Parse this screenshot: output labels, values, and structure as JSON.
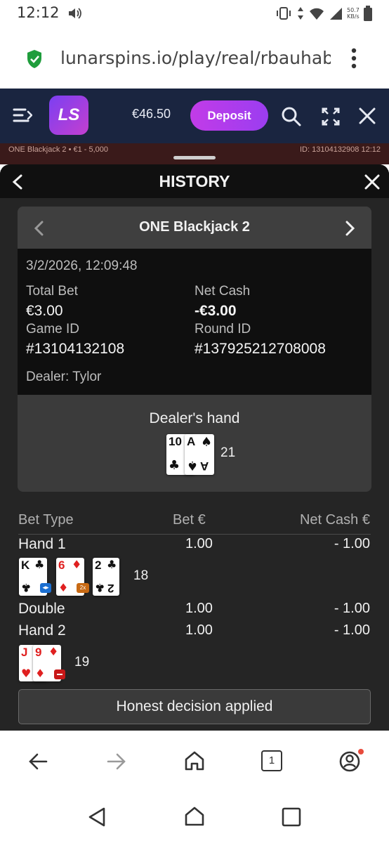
{
  "status_bar": {
    "time": "12:12",
    "net_speed": "50.7",
    "net_unit": "KB/s"
  },
  "browser": {
    "url": "lunarspins.io/play/real/rbauhaba"
  },
  "casino": {
    "balance": "€46.50",
    "deposit_label": "Deposit",
    "logo_text": "LS"
  },
  "game_strip": {
    "left": "ONE Blackjack 2 • €1 - 5,000",
    "right": "ID: 13104132908 12:12"
  },
  "history": {
    "title": "HISTORY",
    "game_name": "ONE Blackjack 2",
    "datetime": "3/2/2026, 12:09:48",
    "total_bet_label": "Total Bet",
    "total_bet": "€3.00",
    "net_cash_label": "Net Cash",
    "net_cash": "-€3.00",
    "game_id_label": "Game ID",
    "game_id": "#13104132108",
    "round_id_label": "Round ID",
    "round_id": "#137925212708008",
    "dealer": "Dealer: Tylor",
    "dealer_hand_label": "Dealer's hand",
    "dealer_cards": [
      {
        "rank": "10",
        "suit": "♣",
        "color": "black"
      },
      {
        "rank": "A",
        "suit": "♠",
        "color": "black"
      }
    ],
    "dealer_total": "21",
    "table": {
      "col_bet_type": "Bet Type",
      "col_bet": "Bet €",
      "col_net": "Net Cash €",
      "rows": [
        {
          "type": "Hand 1",
          "bet": "1.00",
          "net": "- 1.00"
        },
        {
          "type": "Double",
          "bet": "1.00",
          "net": "- 1.00"
        },
        {
          "type": "Hand 2",
          "bet": "1.00",
          "net": "- 1.00"
        }
      ],
      "hand1_cards": [
        {
          "rank": "K",
          "suit": "♣",
          "color": "black",
          "badge": "split"
        },
        {
          "rank": "6",
          "suit": "♦",
          "color": "red",
          "badge": "2x"
        },
        {
          "rank": "2",
          "suit": "♣",
          "color": "black",
          "badge": ""
        }
      ],
      "hand1_total": "18",
      "hand2_cards": [
        {
          "rank": "J",
          "suit": "♥",
          "color": "red",
          "badge": ""
        },
        {
          "rank": "9",
          "suit": "♦",
          "color": "red",
          "badge": "minus"
        }
      ],
      "hand2_total": "19"
    },
    "honest_label": "Honest decision applied"
  },
  "colors": {
    "header_bg": "#1a2540",
    "deposit": "#b83cec",
    "panel_bg": "#252525"
  }
}
